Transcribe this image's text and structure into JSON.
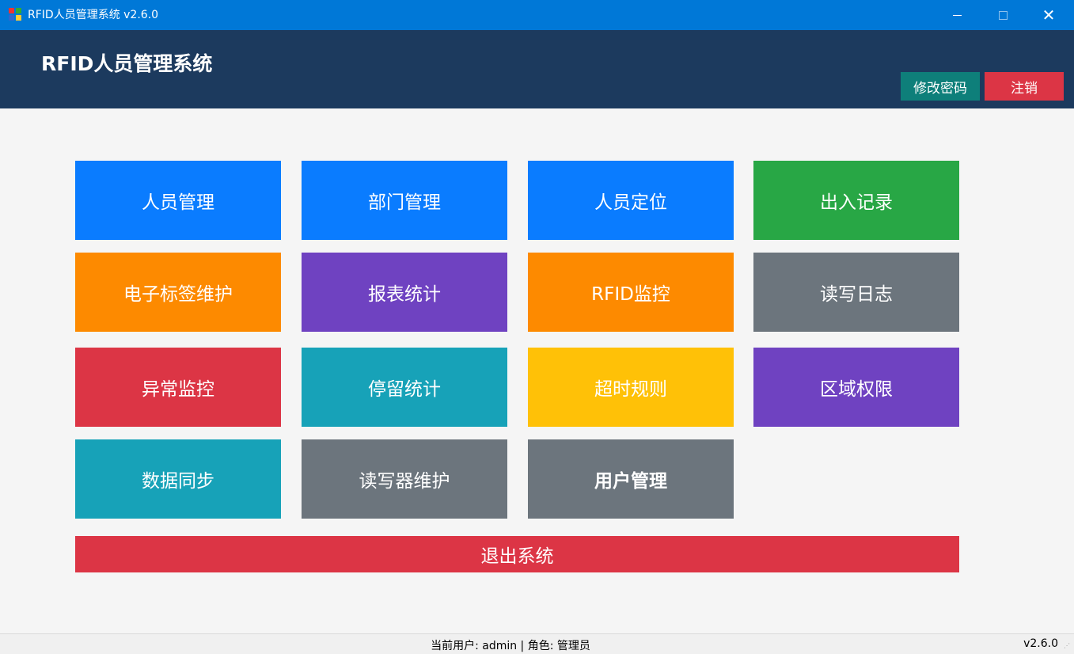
{
  "window": {
    "title": "RFID人员管理系统 v2.6.0",
    "close_symbol": "✕"
  },
  "header": {
    "title": "RFID人员管理系统",
    "change_password_label": "修改密码",
    "logout_label": "注销"
  },
  "tiles": [
    {
      "label": "人员管理",
      "color": "#0a7cff"
    },
    {
      "label": "部门管理",
      "color": "#0a7cff"
    },
    {
      "label": "人员定位",
      "color": "#0a7cff"
    },
    {
      "label": "出入记录",
      "color": "#28a745"
    },
    {
      "label": "电子标签维护",
      "color": "#fd8a00"
    },
    {
      "label": "报表统计",
      "color": "#6f42c1"
    },
    {
      "label": "RFID监控",
      "color": "#fd8a00"
    },
    {
      "label": "读写日志",
      "color": "#6c757d"
    },
    {
      "label": "异常监控",
      "color": "#dc3545"
    },
    {
      "label": "停留统计",
      "color": "#17a2b8"
    },
    {
      "label": "超时规则",
      "color": "#ffc107"
    },
    {
      "label": "区域权限",
      "color": "#6f42c1"
    },
    {
      "label": "数据同步",
      "color": "#17a2b8"
    },
    {
      "label": "读写器维护",
      "color": "#6c757d"
    },
    {
      "label": "用户管理",
      "color": "#6c757d"
    }
  ],
  "exit_label": "退出系统",
  "status": {
    "user_text": "当前用户: admin | 角色: 管理员",
    "version": "v2.6.0"
  }
}
